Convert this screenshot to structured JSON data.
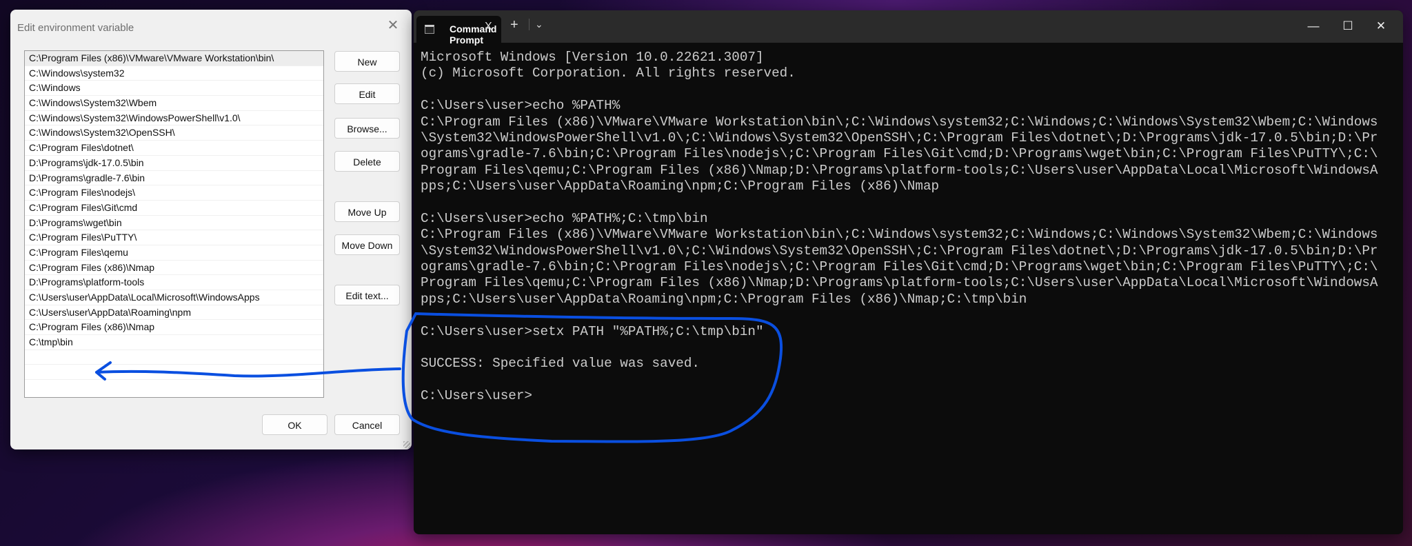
{
  "dialog": {
    "title": "Edit environment variable",
    "close_label": "✕",
    "items": [
      "C:\\Program Files (x86)\\VMware\\VMware Workstation\\bin\\",
      "C:\\Windows\\system32",
      "C:\\Windows",
      "C:\\Windows\\System32\\Wbem",
      "C:\\Windows\\System32\\WindowsPowerShell\\v1.0\\",
      "C:\\Windows\\System32\\OpenSSH\\",
      "C:\\Program Files\\dotnet\\",
      "D:\\Programs\\jdk-17.0.5\\bin",
      "D:\\Programs\\gradle-7.6\\bin",
      "C:\\Program Files\\nodejs\\",
      "C:\\Program Files\\Git\\cmd",
      "D:\\Programs\\wget\\bin",
      "C:\\Program Files\\PuTTY\\",
      "C:\\Program Files\\qemu",
      "C:\\Program Files (x86)\\Nmap",
      "D:\\Programs\\platform-tools",
      "C:\\Users\\user\\AppData\\Local\\Microsoft\\WindowsApps",
      "C:\\Users\\user\\AppData\\Roaming\\npm",
      "C:\\Program Files (x86)\\Nmap",
      "C:\\tmp\\bin",
      "",
      ""
    ],
    "buttons": {
      "new": "New",
      "edit": "Edit",
      "browse": "Browse...",
      "delete": "Delete",
      "move_up": "Move Up",
      "move_down": "Move Down",
      "edit_text": "Edit text...",
      "ok": "OK",
      "cancel": "Cancel"
    }
  },
  "terminal": {
    "tab_title": "Command Prompt",
    "tab_close": "X",
    "new_tab": "+",
    "dropdown": "⌄",
    "minimize": "—",
    "maximize": "☐",
    "close": "✕",
    "lines": [
      "Microsoft Windows [Version 10.0.22621.3007]",
      "(c) Microsoft Corporation. All rights reserved.",
      "",
      "C:\\Users\\user>echo %PATH%",
      "C:\\Program Files (x86)\\VMware\\VMware Workstation\\bin\\;C:\\Windows\\system32;C:\\Windows;C:\\Windows\\System32\\Wbem;C:\\Windows",
      "\\System32\\WindowsPowerShell\\v1.0\\;C:\\Windows\\System32\\OpenSSH\\;C:\\Program Files\\dotnet\\;D:\\Programs\\jdk-17.0.5\\bin;D:\\Pr",
      "ograms\\gradle-7.6\\bin;C:\\Program Files\\nodejs\\;C:\\Program Files\\Git\\cmd;D:\\Programs\\wget\\bin;C:\\Program Files\\PuTTY\\;C:\\",
      "Program Files\\qemu;C:\\Program Files (x86)\\Nmap;D:\\Programs\\platform-tools;C:\\Users\\user\\AppData\\Local\\Microsoft\\WindowsA",
      "pps;C:\\Users\\user\\AppData\\Roaming\\npm;C:\\Program Files (x86)\\Nmap",
      "",
      "C:\\Users\\user>echo %PATH%;C:\\tmp\\bin",
      "C:\\Program Files (x86)\\VMware\\VMware Workstation\\bin\\;C:\\Windows\\system32;C:\\Windows;C:\\Windows\\System32\\Wbem;C:\\Windows",
      "\\System32\\WindowsPowerShell\\v1.0\\;C:\\Windows\\System32\\OpenSSH\\;C:\\Program Files\\dotnet\\;D:\\Programs\\jdk-17.0.5\\bin;D:\\Pr",
      "ograms\\gradle-7.6\\bin;C:\\Program Files\\nodejs\\;C:\\Program Files\\Git\\cmd;D:\\Programs\\wget\\bin;C:\\Program Files\\PuTTY\\;C:\\",
      "Program Files\\qemu;C:\\Program Files (x86)\\Nmap;D:\\Programs\\platform-tools;C:\\Users\\user\\AppData\\Local\\Microsoft\\WindowsA",
      "pps;C:\\Users\\user\\AppData\\Roaming\\npm;C:\\Program Files (x86)\\Nmap;C:\\tmp\\bin",
      "",
      "C:\\Users\\user>setx PATH \"%PATH%;C:\\tmp\\bin\"",
      "",
      "SUCCESS: Specified value was saved.",
      "",
      "C:\\Users\\user>"
    ]
  },
  "annotation": {
    "color": "#0a4fe0"
  }
}
